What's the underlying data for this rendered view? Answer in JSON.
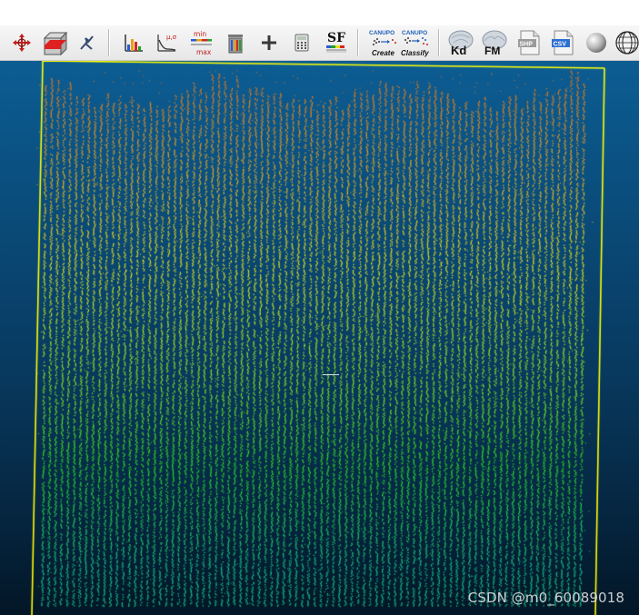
{
  "toolbar": {
    "buttons": [
      {
        "icon": "translate-rotate-icon"
      },
      {
        "icon": "cross-section-box-icon"
      },
      {
        "icon": "point-picking-icon"
      },
      {
        "icon": "histogram-icon"
      },
      {
        "icon": "fit-distribution-icon",
        "label": "μ,σ"
      },
      {
        "icon": "min-max-filter-icon",
        "label_top": "min",
        "label_bottom": "max"
      },
      {
        "icon": "delete-scalar-field-icon"
      },
      {
        "icon": "add-constant-sf-icon"
      },
      {
        "icon": "calculator-icon"
      },
      {
        "icon": "scalar-field-icon",
        "label": "SF"
      },
      {
        "icon": "canupo-create-icon",
        "label_top": "CANUPO",
        "label_bottom": "Create"
      },
      {
        "icon": "canupo-classify-icon",
        "label_top": "CANUPO",
        "label_bottom": "Classify"
      },
      {
        "icon": "kd-tree-icon",
        "label": "Kd"
      },
      {
        "icon": "fast-marching-icon",
        "label": "FM"
      },
      {
        "icon": "shp-file-icon",
        "label": "SHP"
      },
      {
        "icon": "csv-file-icon",
        "label": "CSV"
      },
      {
        "icon": "sphere-icon"
      },
      {
        "icon": "globe-icon"
      }
    ]
  },
  "viewport": {
    "content": "point-cloud",
    "colormap": [
      "#e36a1a",
      "#f0a81c",
      "#e8e61c",
      "#9be81c",
      "#2ee31c",
      "#16c88e"
    ],
    "bbox_color": "#ffff00",
    "background_top": "#0c5d93",
    "background_bottom": "#031626"
  },
  "watermark": {
    "text": "CSDN @m0_60089018"
  }
}
